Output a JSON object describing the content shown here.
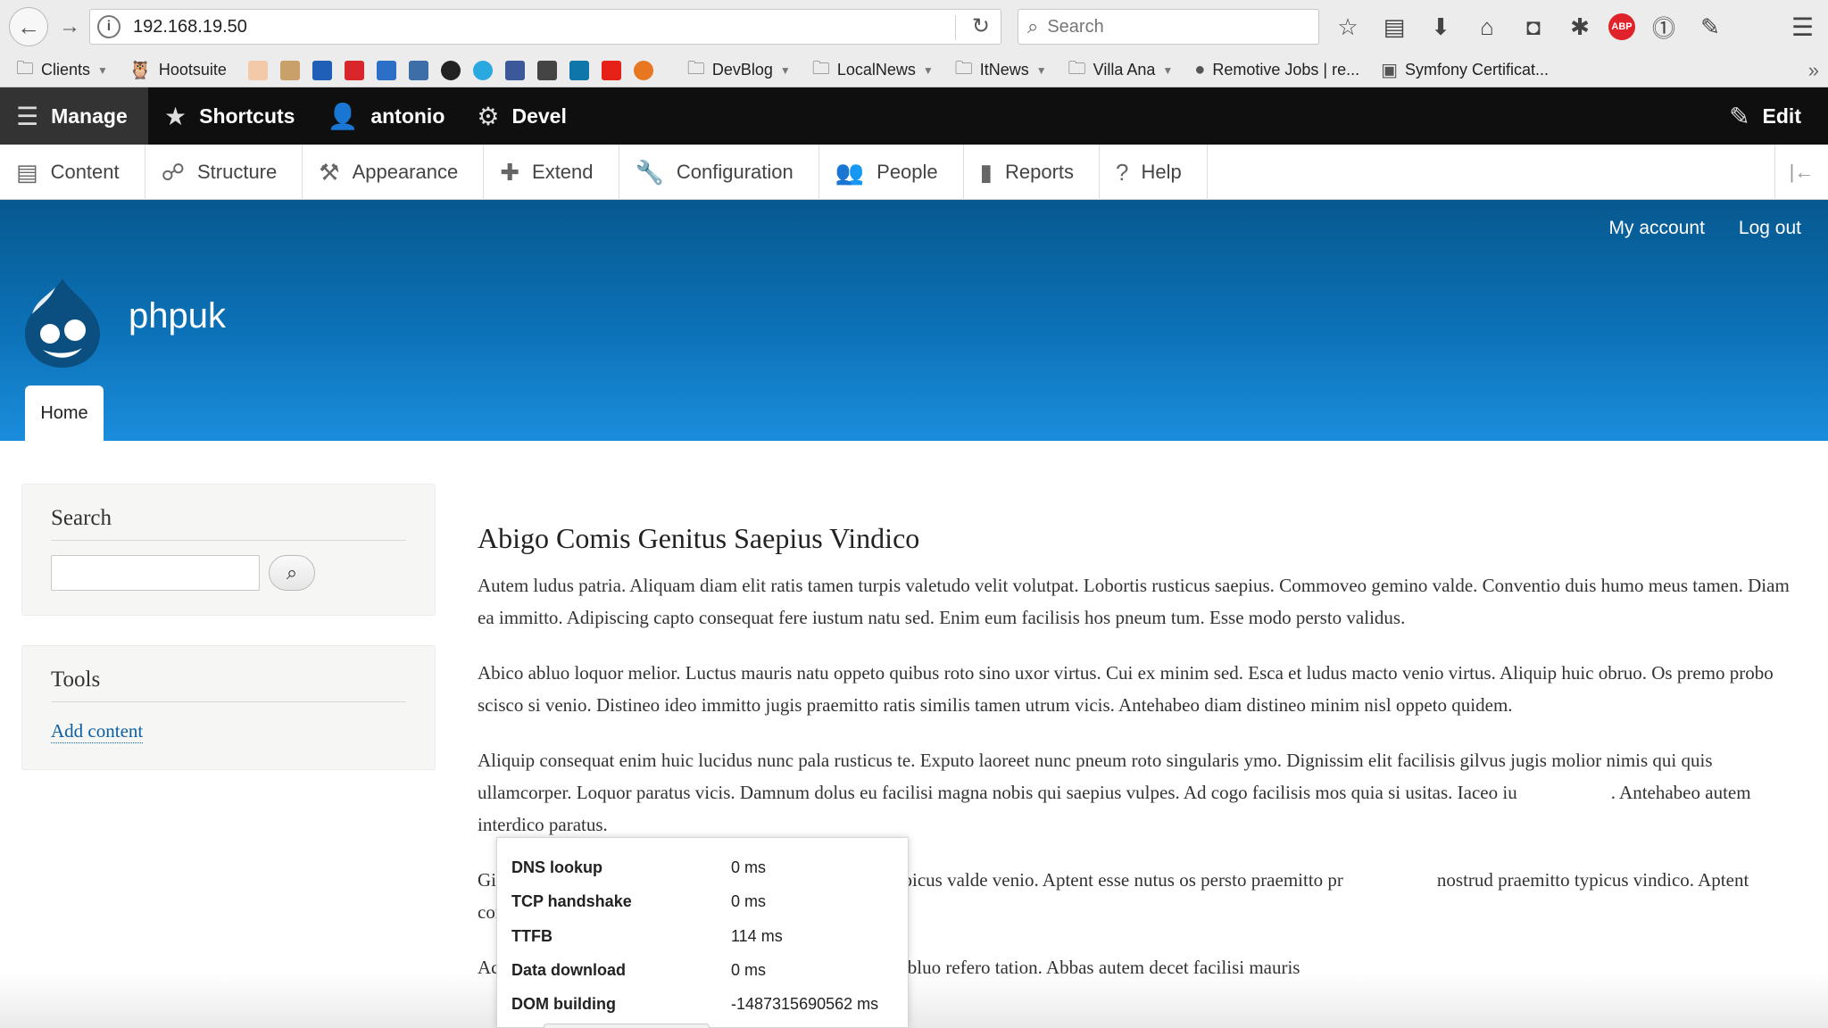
{
  "browser": {
    "url": "192.168.19.50",
    "search_placeholder": "Search",
    "bookmarks": [
      {
        "label": "Clients",
        "folder": true
      },
      {
        "label": "Hootsuite",
        "folder": false
      },
      {
        "label": "DevBlog",
        "folder": true
      },
      {
        "label": "LocalNews",
        "folder": true
      },
      {
        "label": "ItNews",
        "folder": true
      },
      {
        "label": "Villa Ana",
        "folder": true
      },
      {
        "label": "Remotive Jobs | re...",
        "folder": false
      },
      {
        "label": "Symfony Certificat...",
        "folder": false
      }
    ],
    "colors": {
      "chrome": "#ececec",
      "abp": "#e0232a"
    }
  },
  "toolbar": {
    "manage": "Manage",
    "shortcuts": "Shortcuts",
    "user": "antonio",
    "devel": "Devel",
    "edit": "Edit"
  },
  "admin_menu": [
    {
      "label": "Content",
      "icon": "file-icon"
    },
    {
      "label": "Structure",
      "icon": "sitemap-icon"
    },
    {
      "label": "Appearance",
      "icon": "brush-icon"
    },
    {
      "label": "Extend",
      "icon": "puzzle-icon"
    },
    {
      "label": "Configuration",
      "icon": "wrench-icon"
    },
    {
      "label": "People",
      "icon": "people-icon"
    },
    {
      "label": "Reports",
      "icon": "bar-chart-icon"
    },
    {
      "label": "Help",
      "icon": "help-icon"
    }
  ],
  "header": {
    "my_account": "My account",
    "log_out": "Log out",
    "site_name": "phpuk",
    "tab_home": "Home",
    "colors": {
      "gradient_top": "#07598f",
      "gradient_bottom": "#1b8ddc"
    }
  },
  "sidebar": {
    "search_title": "Search",
    "tools_title": "Tools",
    "add_content": "Add content"
  },
  "article": {
    "title": "Abigo Comis Genitus Saepius Vindico",
    "paragraphs": [
      "Autem ludus patria. Aliquam diam elit ratis tamen turpis valetudo velit volutpat. Lobortis rusticus saepius. Commoveo gemino valde. Conventio duis humo meus tamen. Diam ea immitto. Adipiscing capto consequat fere iustum natu sed. Enim eum facilisis hos pneum tum. Esse modo persto validus.",
      "Abico abluo loquor melior. Luctus mauris natu oppeto quibus roto sino uxor virtus. Cui ex minim sed. Esca et ludus macto venio virtus. Aliquip huic obruo. Os premo probo scisco si venio. Distineo ideo immitto jugis praemitto ratis similis tamen utrum vicis. Antehabeo diam distineo minim nisl oppeto quidem.",
      "Aliquip consequat enim huic lucidus nunc pala rusticus te. Exputo laoreet nunc pneum roto singularis ymo. Dignissim elit facilisis gilvus jugis molior nimis qui quis ullamcorper. Loquor paratus vicis. Damnum dolus eu facilisi magna nobis qui saepius vulpes. Ad cogo facilisis mos quia si usitas. Iaceo iu                    . Antehabeo autem interdico paratus.",
      "Gi                    uidne. Diam eros metuo praemitto quia typicus valde venio. Aptent esse nutus os persto praemitto pr                    nostrud praemitto typicus vindico. Aptent conventio diam nutus olim saluto validus.",
      "Ac                    quat meus nibh nimis nisl premo. Abbas abluo refero tation. Abbas autem decet facilisi mauris"
    ]
  },
  "timing": [
    {
      "label": "DNS lookup",
      "value": "0 ms"
    },
    {
      "label": "TCP handshake",
      "value": "0 ms"
    },
    {
      "label": "TTFB",
      "value": "114 ms"
    },
    {
      "label": "Data download",
      "value": "0 ms"
    },
    {
      "label": "DOM building",
      "value": "-1487315690562 ms"
    }
  ]
}
